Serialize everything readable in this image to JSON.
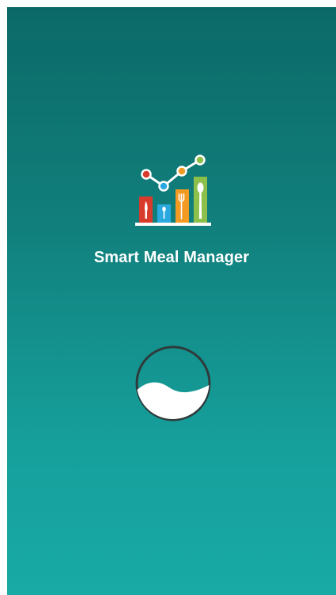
{
  "app": {
    "title": "Smart Meal Manager",
    "logo_icon": "meal-chart-icon",
    "loading_icon": "bowl-loading-icon"
  },
  "colors": {
    "bg_top": "#0b6a68",
    "bg_bottom": "#19aaa6",
    "bar_red": "#d83b2b",
    "bar_blue": "#29a9e0",
    "bar_orange": "#f39a22",
    "bar_green": "#8cc04b",
    "loader_ring": "#2f3a3b",
    "text": "#ffffff"
  }
}
